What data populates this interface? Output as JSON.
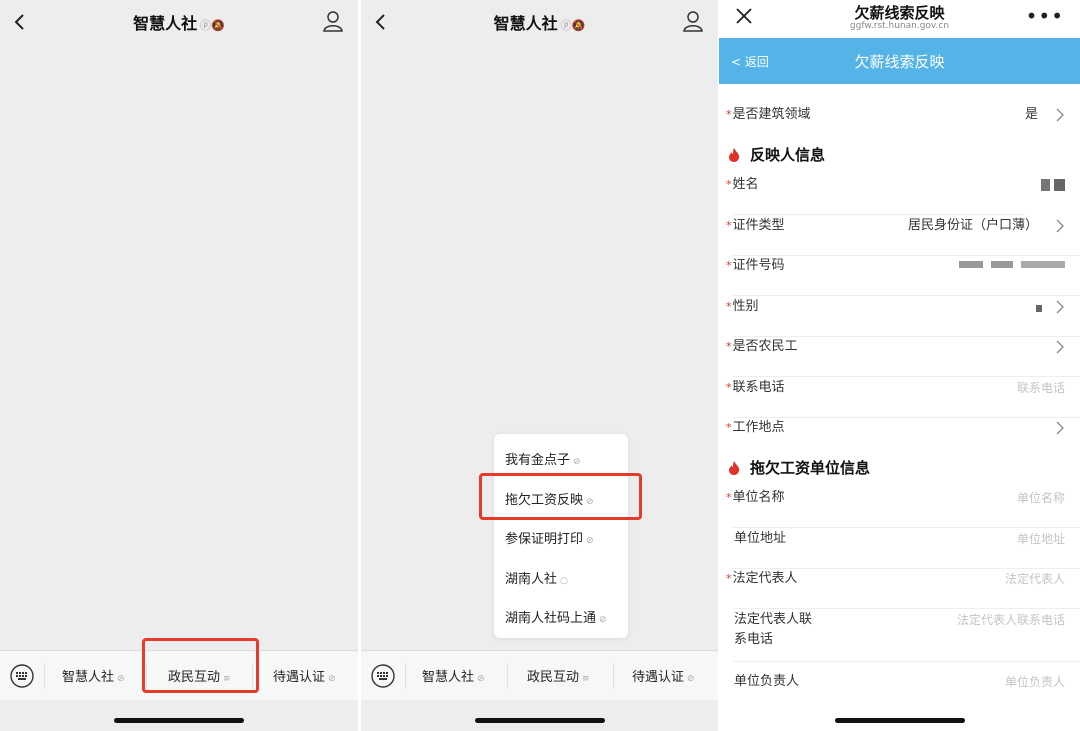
{
  "panel1": {
    "chat_title": "智慧人社",
    "title_icons": "ⓟ🔕",
    "menu": [
      {
        "label": "智慧人社",
        "suffix": "⊘"
      },
      {
        "label": "政民互动",
        "suffix": "≡"
      },
      {
        "label": "待遇认证",
        "suffix": "⊘"
      }
    ]
  },
  "panel2": {
    "chat_title": "智慧人社",
    "title_icons": "ⓟ🔕",
    "menu": [
      {
        "label": "智慧人社",
        "suffix": "⊘"
      },
      {
        "label": "政民互动",
        "suffix": "≡"
      },
      {
        "label": "待遇认证",
        "suffix": "⊘"
      }
    ],
    "submenu": [
      {
        "label": "我有金点子",
        "suffix": "⊘"
      },
      {
        "label": "拖欠工资反映",
        "suffix": "⊘"
      },
      {
        "label": "参保证明打印",
        "suffix": "⊘"
      },
      {
        "label": "湖南人社",
        "suffix": "○"
      },
      {
        "label": "湖南人社码上通",
        "suffix": "⊘"
      }
    ]
  },
  "panel3": {
    "page_title": "欠薪线索反映",
    "url": "ggfw.rst.hunan.gov.cn",
    "more": "•••",
    "back_label": "返回",
    "nav_title": "欠薪线索反映",
    "field_construction": {
      "label": "是否建筑领域",
      "value": "是"
    },
    "section_reporter": "反映人信息",
    "fields_reporter": [
      {
        "label": "姓名"
      },
      {
        "label": "证件类型",
        "value": "居民身份证（户口薄）"
      },
      {
        "label": "证件号码"
      },
      {
        "label": "性别"
      },
      {
        "label": "是否农民工"
      },
      {
        "label": "联系电话",
        "placeholder": "联系电话"
      },
      {
        "label": "工作地点"
      }
    ],
    "section_employer": "拖欠工资单位信息",
    "fields_employer": [
      {
        "label": "单位名称",
        "placeholder": "单位名称"
      },
      {
        "label": "单位地址",
        "placeholder": "单位地址"
      },
      {
        "label": "法定代表人",
        "placeholder": "法定代表人"
      },
      {
        "label_line1": "法定代表人联",
        "label_line2": "系电话",
        "placeholder": "法定代表人联系电话"
      },
      {
        "label": "单位负责人",
        "placeholder": "单位负责人"
      }
    ],
    "required_mark": "*",
    "back_glyph": "<"
  },
  "colors": {
    "highlight_box": "#e63a2a",
    "nav_bar": "#54b4e8",
    "required_star": "#e0322a",
    "fire_icon": "#e0322a"
  }
}
